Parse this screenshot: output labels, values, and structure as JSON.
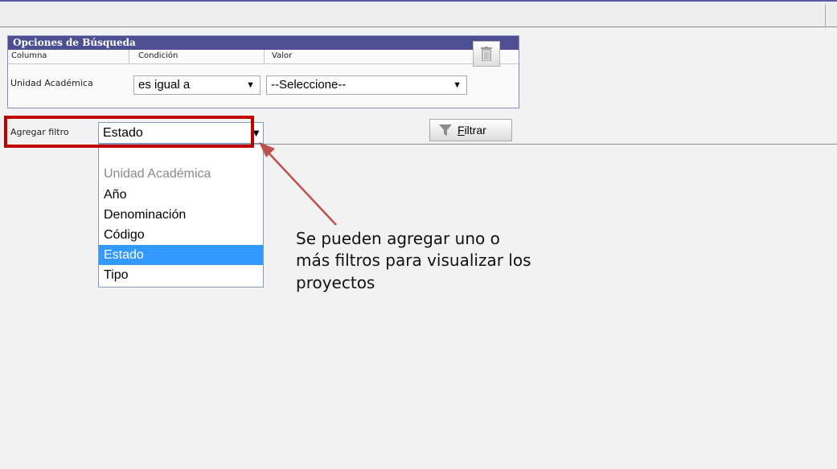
{
  "panel": {
    "title": "Opciones de Búsqueda"
  },
  "columns": {
    "col1": "Columna",
    "col2": "Condición",
    "col3": "Valor"
  },
  "filter_row": {
    "column_label": "Unidad Académica",
    "condition_value": "es igual a",
    "value_value": "--Seleccione--"
  },
  "add_filter": {
    "label": "Agregar filtro",
    "selected": "Estado"
  },
  "buttons": {
    "filter_underlined": "F",
    "filter_rest": "iltrar"
  },
  "dropdown_options": [
    {
      "label": "Unidad Académica",
      "state": "disabled"
    },
    {
      "label": "Año",
      "state": "normal"
    },
    {
      "label": "Denominación",
      "state": "normal"
    },
    {
      "label": "Código",
      "state": "normal"
    },
    {
      "label": "Estado",
      "state": "selected"
    },
    {
      "label": "Tipo",
      "state": "normal"
    }
  ],
  "annotation": {
    "line1": "Se pueden agregar uno o",
    "line2": "más filtros para visualizar los",
    "line3": "proyectos"
  },
  "colors": {
    "panel_header": "#4d4f92",
    "highlight": "#c00000",
    "selection": "#3399ff",
    "arrow": "#c0504d"
  },
  "icons": {
    "delete": "trash-icon",
    "filter": "funnel-icon",
    "arrow": "dropdown-arrow-icon"
  }
}
